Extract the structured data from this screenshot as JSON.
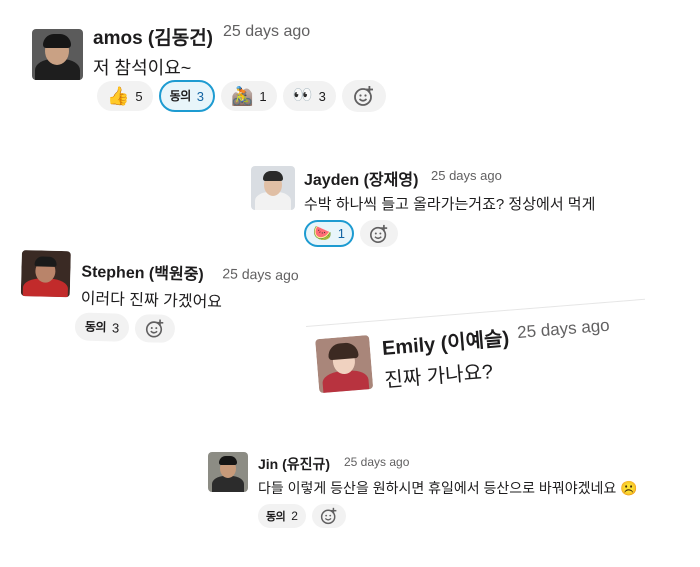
{
  "messages": [
    {
      "author": "amos (김동건)",
      "time": "25 days ago",
      "text": "저 참석이요~",
      "reactions": [
        {
          "emoji": "👍",
          "count": "5",
          "mine": false
        },
        {
          "emoji": "동의",
          "count": "3",
          "mine": true
        },
        {
          "emoji": "🚵",
          "count": "1",
          "mine": false
        },
        {
          "emoji": "👀",
          "count": "3",
          "mine": false
        }
      ]
    },
    {
      "author": "Jayden (장재영)",
      "time": "25 days ago",
      "text": "수박 하나씩 들고 올라가는거죠? 정상에서 먹게",
      "reactions": [
        {
          "emoji": "🍉",
          "count": "1",
          "mine": true
        }
      ]
    },
    {
      "author": "Stephen (백원중)",
      "time": "25 days ago",
      "text": "이러다 진짜 가겠어요",
      "reactions": [
        {
          "emoji": "동의",
          "count": "3",
          "mine": false
        }
      ]
    },
    {
      "author": "Emily (이예슬)",
      "time": "25 days ago",
      "text": "진짜 가나요?"
    },
    {
      "author": "Jin (유진규)",
      "time": "25 days ago",
      "text": "다들 이렇게 등산을 원하시면 휴일에서 등산으로 바꿔야겠네요 ☹️",
      "reactions": [
        {
          "emoji": "동의",
          "count": "2",
          "mine": false
        }
      ]
    }
  ],
  "colors": {
    "accent": "#1d9bd1",
    "mine_bg": "#e8f5fa",
    "reaction_bg": "#f2f2f2",
    "timestamp": "#616061"
  }
}
